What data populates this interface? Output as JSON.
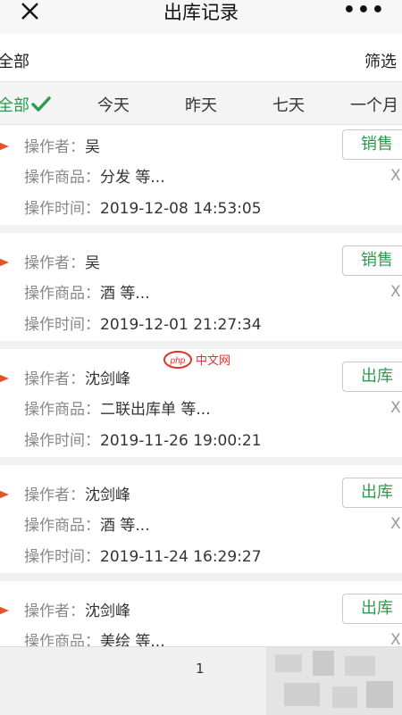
{
  "header": {
    "title": "出库记录",
    "more": "•••"
  },
  "filterbar": {
    "all_label": "全部",
    "filter_label": "筛选"
  },
  "tabs": [
    {
      "label": "全部",
      "active": true
    },
    {
      "label": "今天"
    },
    {
      "label": "昨天"
    },
    {
      "label": "七天"
    },
    {
      "label": "一个月"
    }
  ],
  "labels": {
    "operator": "操作者：",
    "goods": "操作商品：",
    "time": "操作时间：",
    "delete": "X"
  },
  "records": [
    {
      "operator": "吴",
      "goods": "分发 等...",
      "time": "2019-12-08 14:53:05",
      "type": "销售"
    },
    {
      "operator": "吴",
      "goods": "酒 等...",
      "time": "2019-12-01 21:27:34",
      "type": "销售"
    },
    {
      "operator": "沈剑峰",
      "goods": "二联出库单 等...",
      "time": "2019-11-26 19:00:21",
      "type": "出库"
    },
    {
      "operator": "沈剑峰",
      "goods": "酒 等...",
      "time": "2019-11-24 16:29:27",
      "type": "出库"
    },
    {
      "operator": "沈剑峰",
      "goods": "美绘 等...",
      "time": "",
      "type": "出库"
    }
  ],
  "pager": {
    "page": "1"
  },
  "watermark": {
    "text": "php 中文网"
  },
  "colors": {
    "accent": "#2e9a4e",
    "arrow": "#e2522b",
    "watermark": "#e3322b"
  }
}
